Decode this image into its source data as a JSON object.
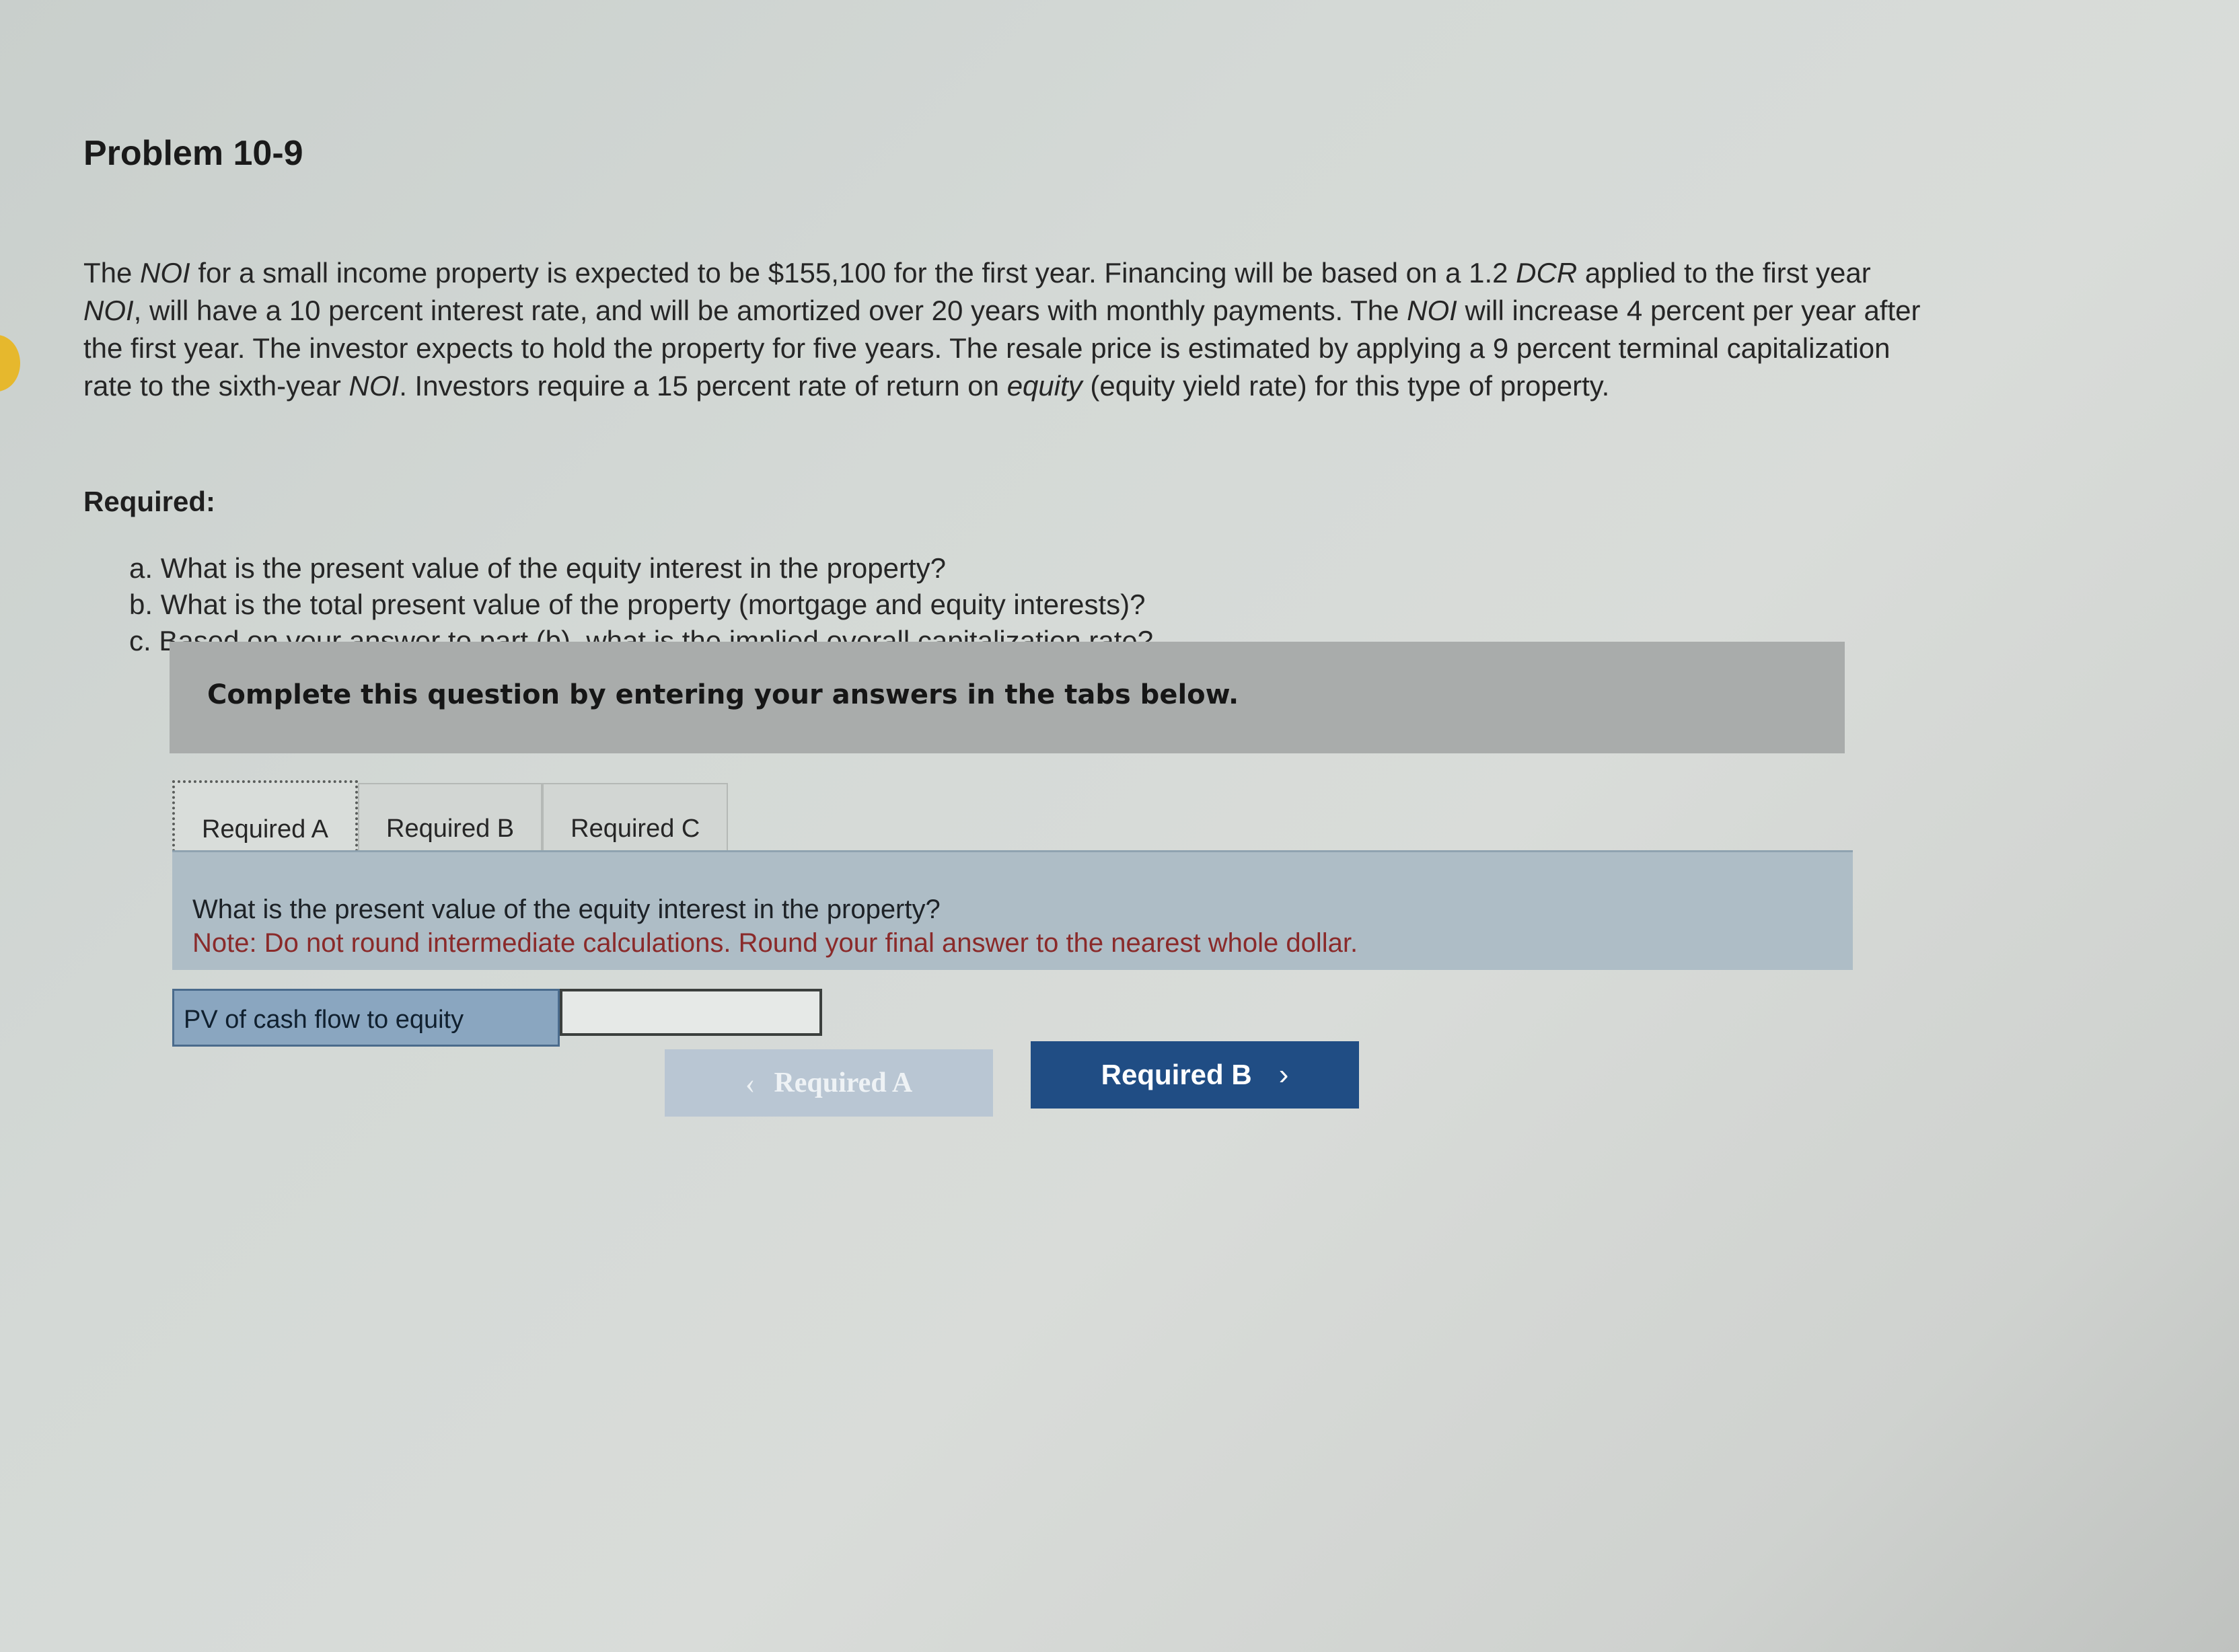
{
  "problem": {
    "title": "Problem 10-9",
    "text_parts": [
      "The ",
      "NOI",
      " for a small income property is expected to be $155,100 for the first year. Financing will be based on a 1.2 ",
      "DCR",
      " applied to the first year ",
      "NOI",
      ", will have a 10 percent interest rate, and will be amortized over 20 years with monthly payments. The ",
      "NOI",
      " will increase 4 percent per year after the first year. The investor expects to hold the property for five years. The resale price is estimated by applying a 9 percent terminal capitalization rate to the sixth-year ",
      "NOI",
      ". Investors require a 15 percent rate of return on ",
      "equity",
      " (equity yield rate) for this type of property."
    ]
  },
  "required": {
    "heading": "Required:",
    "items": [
      "a. What is the present value of the equity interest in the property?",
      "b. What is the total present value of the property (mortgage and equity interests)?",
      "c. Based on your answer to part (b), what is the implied overall capitalization rate?"
    ]
  },
  "instructions": "Complete this question by entering your answers in the tabs below.",
  "tabs": [
    {
      "label": "Required A",
      "active": true
    },
    {
      "label": "Required B",
      "active": false
    },
    {
      "label": "Required C",
      "active": false
    }
  ],
  "question": {
    "prompt": "What is the present value of the equity interest in the property?",
    "note": "Note: Do not round intermediate calculations. Round your final answer to the nearest whole dollar."
  },
  "answer": {
    "label": "PV of cash flow to equity",
    "value": ""
  },
  "nav": {
    "prev_label": "Required A",
    "next_label": "Required B",
    "prev_icon": "chevron-left-icon",
    "next_icon": "chevron-right-icon"
  },
  "colors": {
    "next_button": "#204d84",
    "note_text": "#8a2a2a",
    "question_panel": "#aebdc6"
  }
}
